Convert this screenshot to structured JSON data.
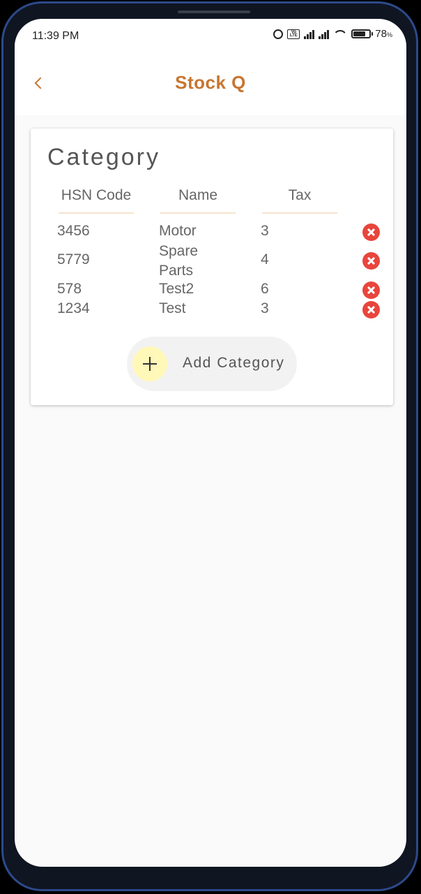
{
  "status_bar": {
    "time": "11:39 PM",
    "battery_level": "78",
    "battery_unit": "%",
    "volte_label": "Vo LTE",
    "icons": [
      "alarm-icon",
      "volte-icon",
      "signal-icon",
      "signal-icon",
      "wifi-icon",
      "battery-icon"
    ]
  },
  "app_bar": {
    "title": "Stock Q",
    "back_icon": "chevron-left-icon",
    "accent_color": "#c8752f"
  },
  "card": {
    "title": "Category",
    "columns": [
      "HSN Code",
      "Name",
      "Tax"
    ],
    "rows": [
      {
        "hsn": "3456",
        "name": "Motor",
        "tax": "3"
      },
      {
        "hsn": "5779",
        "name": "Spare Parts",
        "tax": "4"
      },
      {
        "hsn": "578",
        "name": "Test2",
        "tax": "6"
      },
      {
        "hsn": "1234",
        "name": "Test",
        "tax": "3"
      }
    ],
    "delete_icon": "close-circle-icon",
    "delete_color": "#e8453c",
    "add_button": {
      "label": "Add Category",
      "icon": "plus-icon"
    }
  }
}
